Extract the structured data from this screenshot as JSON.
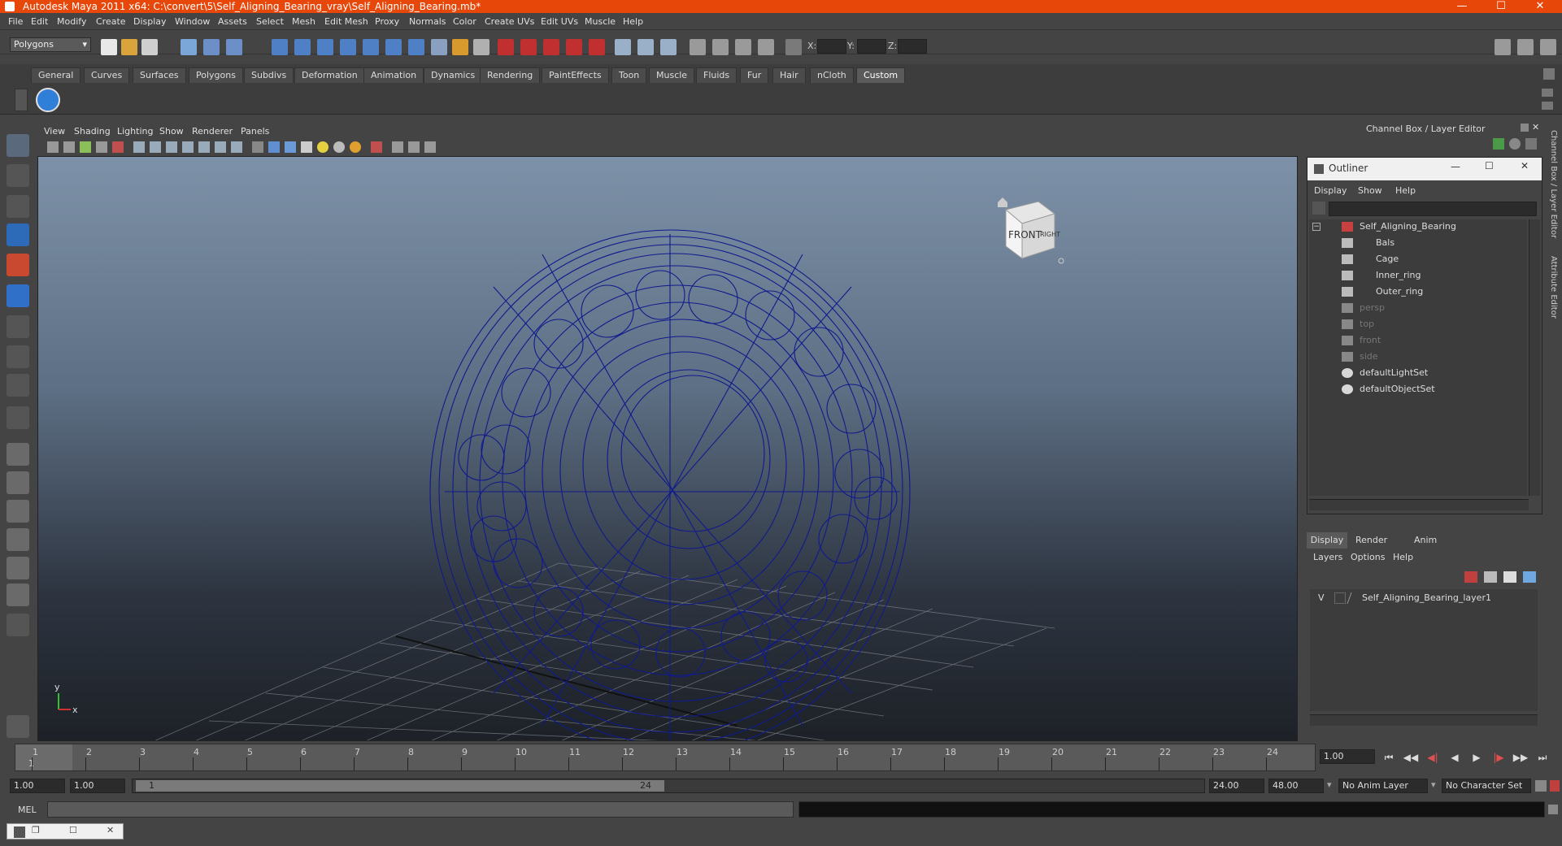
{
  "window": {
    "title": "Autodesk Maya 2011 x64: C:\\convert\\5\\Self_Aligning_Bearing_vray\\Self_Aligning_Bearing.mb*"
  },
  "menubar": [
    "File",
    "Edit",
    "Modify",
    "Create",
    "Display",
    "Window",
    "Assets",
    "Select",
    "Mesh",
    "Edit Mesh",
    "Proxy",
    "Normals",
    "Color",
    "Create UVs",
    "Edit UVs",
    "Muscle",
    "Help"
  ],
  "statusline": {
    "mode": "Polygons",
    "x_label": "X:",
    "y_label": "Y:",
    "z_label": "Z:"
  },
  "shelf": {
    "tabs": [
      "General",
      "Curves",
      "Surfaces",
      "Polygons",
      "Subdivs",
      "Deformation",
      "Animation",
      "Dynamics",
      "Rendering",
      "PaintEffects",
      "Toon",
      "Muscle",
      "Fluids",
      "Fur",
      "Hair",
      "nCloth",
      "Custom"
    ],
    "active": "Custom"
  },
  "panel_menu": [
    "View",
    "Shading",
    "Lighting",
    "Show",
    "Renderer",
    "Panels"
  ],
  "viewcube": {
    "front": "FRONT",
    "right": "RIGHT"
  },
  "axis": {
    "y": "y",
    "x": "x"
  },
  "channel_box_title": "Channel Box / Layer Editor",
  "side_tabs": [
    "Channel Box / Layer Editor",
    "Attribute Editor"
  ],
  "outliner": {
    "title": "Outliner",
    "menu": [
      "Display",
      "Show",
      "Help"
    ],
    "items": [
      {
        "label": "Self_Aligning_Bearing",
        "depth": 0,
        "dim": false,
        "icon": "group-icon"
      },
      {
        "label": "Bals",
        "depth": 1,
        "dim": false,
        "icon": "mesh-icon"
      },
      {
        "label": "Cage",
        "depth": 1,
        "dim": false,
        "icon": "mesh-icon"
      },
      {
        "label": "Inner_ring",
        "depth": 1,
        "dim": false,
        "icon": "mesh-icon"
      },
      {
        "label": "Outer_ring",
        "depth": 1,
        "dim": false,
        "icon": "mesh-icon"
      },
      {
        "label": "persp",
        "depth": 0,
        "dim": true,
        "icon": "camera-icon"
      },
      {
        "label": "top",
        "depth": 0,
        "dim": true,
        "icon": "camera-icon"
      },
      {
        "label": "front",
        "depth": 0,
        "dim": true,
        "icon": "camera-icon"
      },
      {
        "label": "side",
        "depth": 0,
        "dim": true,
        "icon": "camera-icon"
      },
      {
        "label": "defaultLightSet",
        "depth": 0,
        "dim": false,
        "icon": "set-icon"
      },
      {
        "label": "defaultObjectSet",
        "depth": 0,
        "dim": false,
        "icon": "set-icon"
      }
    ]
  },
  "layer_editor": {
    "tabs": [
      "Display",
      "Render",
      "Anim"
    ],
    "active_tab": "Display",
    "menu": [
      "Layers",
      "Options",
      "Help"
    ],
    "layers": [
      {
        "visible": "V",
        "name": "Self_Aligning_Bearing_layer1"
      }
    ]
  },
  "timeslider": {
    "ticks": [
      "1",
      "2",
      "3",
      "4",
      "5",
      "6",
      "7",
      "8",
      "9",
      "10",
      "11",
      "12",
      "13",
      "14",
      "15",
      "16",
      "17",
      "18",
      "19",
      "20",
      "21",
      "22",
      "23",
      "24"
    ],
    "current_frame_label": "1",
    "current_time": "1.00"
  },
  "range": {
    "start": "1.00",
    "playback_start": "1.00",
    "slider_start": "1",
    "slider_end": "24",
    "playback_end": "24.00",
    "end": "48.00",
    "anim_layer": "No Anim Layer",
    "character_set": "No Character Set"
  },
  "cmdline": {
    "label": "MEL"
  },
  "colors": {
    "titlebar": "#e8470a",
    "wireframe": "#101a8c",
    "accent_tab": "#5a5a5a"
  }
}
